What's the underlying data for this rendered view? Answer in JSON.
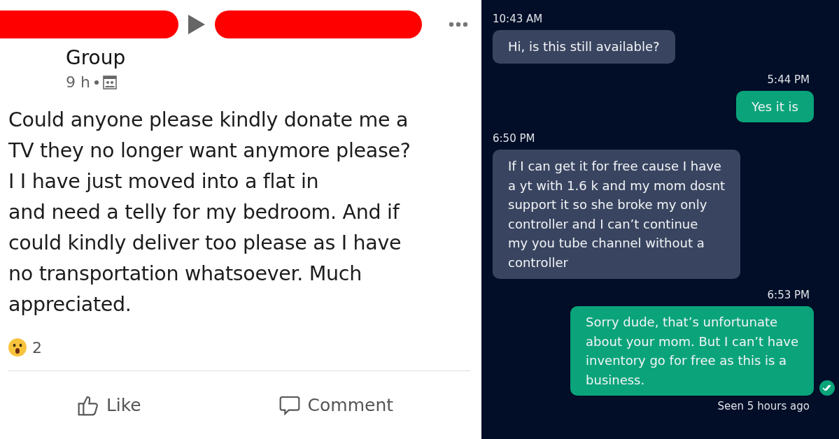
{
  "post": {
    "group_label": "Group",
    "age": "9 h",
    "body_lines": [
      "Could anyone please kindly donate me a",
      "TV they no longer want anymore please?",
      "I I have just moved into a flat in",
      "and need a telly for my bedroom. And if",
      "could kindly deliver too please as I have",
      "no transportation whatsoever. Much",
      "appreciated."
    ],
    "reaction_count": "2",
    "actions": [
      {
        "kind": "like",
        "label": "Like"
      },
      {
        "kind": "comment",
        "label": "Comment"
      }
    ]
  },
  "chat": {
    "messages": [
      {
        "kind": "incoming",
        "time": "10:43 AM",
        "lines": [
          "Hi, is this still available?"
        ]
      },
      {
        "kind": "outgoing",
        "time": "5:44 PM",
        "lines": [
          "Yes it is"
        ]
      },
      {
        "kind": "incoming",
        "time": "6:50 PM",
        "lines": [
          "If I can get it for free cause I have",
          "a yt with 1.6 k and my mom dosnt",
          "support it so she broke my only",
          "controller  and I can’t continue",
          "my you tube channel without a",
          "controller"
        ]
      },
      {
        "kind": "outgoing",
        "time": "6:53 PM",
        "lines": [
          "Sorry dude, that’s unfortunate",
          "about your mom. But I can’t have",
          "inventory go for free as this is a",
          "business."
        ],
        "seen": true
      }
    ],
    "seen_label": "Seen 5 hours ago"
  }
}
